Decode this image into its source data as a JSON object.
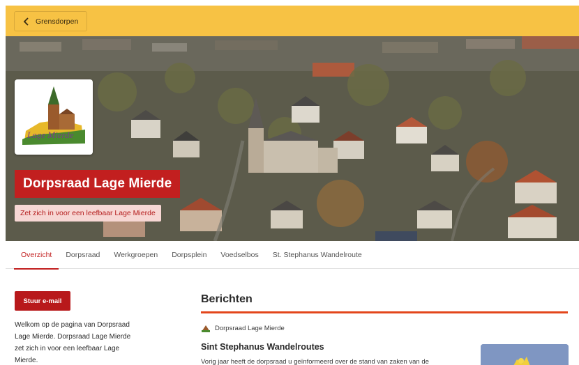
{
  "topbar": {
    "back_label": "Grensdorpen",
    "background": "#f7c244"
  },
  "hero": {
    "title": "Dorpsraad Lage Mierde",
    "subtitle": "Zet zich in voor een leefbaar Lage Mierde",
    "logo_text": "Lage Mierde",
    "title_bg": "#c21f1f",
    "subtitle_bg": "#f7d7d4"
  },
  "tabs": [
    {
      "label": "Overzicht",
      "active": true
    },
    {
      "label": "Dorpsraad",
      "active": false
    },
    {
      "label": "Werkgroepen",
      "active": false
    },
    {
      "label": "Dorpsplein",
      "active": false
    },
    {
      "label": "Voedselbos",
      "active": false
    },
    {
      "label": "St. Stephanus Wandelroute",
      "active": false
    }
  ],
  "sidebar": {
    "email_button": "Stuur e-mail",
    "intro_lines": [
      "Welkom op de pagina van Dorpsraad",
      "Lage Mierde. Dorpsraad Lage Mierde",
      "zet zich in voor een leefbaar Lage",
      "Mierde."
    ]
  },
  "messages": {
    "heading": "Berichten",
    "post": {
      "source": "Dorpsraad Lage Mierde",
      "title": "Sint Stephanus Wandelroutes",
      "excerpt": "Vorig jaar heeft de dorpsraad u geïnformeerd over de stand van zaken van de"
    }
  },
  "colors": {
    "accent_red": "#c21f1f",
    "rule_orange": "#e3461c",
    "yellow": "#f7c244"
  },
  "icons": {
    "back": "chevron-left-icon",
    "source": "church-icon"
  }
}
